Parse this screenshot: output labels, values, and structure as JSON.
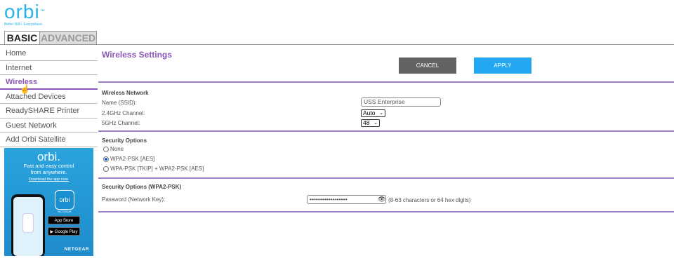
{
  "logo": {
    "brand": "orbi",
    "tm": "™",
    "tagline": "Better WiFi. Everywhere."
  },
  "tabs": {
    "basic": "BASIC",
    "advanced": "ADVANCED"
  },
  "sidebar": {
    "items": [
      {
        "label": "Home"
      },
      {
        "label": "Internet"
      },
      {
        "label": "Wireless"
      },
      {
        "label": "Attached Devices"
      },
      {
        "label": "ReadySHARE Printer"
      },
      {
        "label": "Guest Network"
      },
      {
        "label": "Add Orbi Satellite"
      }
    ],
    "active_index": 2
  },
  "ad": {
    "logo": "orbi.",
    "line1": "Fast and easy control",
    "line2": "from anywhere.",
    "link": "Download the app now.",
    "app_icon_label": "orbi",
    "app_icon_tag": "NETGEAR",
    "app_store": "App Store",
    "google_play": "Google Play",
    "brand": "NETGEAR"
  },
  "page": {
    "title": "Wireless Settings",
    "cancel_label": "CANCEL",
    "apply_label": "APPLY"
  },
  "wireless_network": {
    "title": "Wireless Network",
    "ssid_label": "Name (SSID):",
    "ssid_value": "USS Enterprise",
    "ch24_label": "2.4GHz Channel:",
    "ch24_value": "Auto",
    "ch5_label": "5GHz Channel:",
    "ch5_value": "48"
  },
  "security_options": {
    "title": "Security Options",
    "options": [
      "None",
      "WPA2-PSK [AES]",
      "WPA-PSK [TKIP] + WPA2-PSK [AES]"
    ],
    "selected_index": 1
  },
  "wpa2": {
    "title": "Security Options (WPA2-PSK)",
    "password_label": "Password (Network Key):",
    "password_value": "••••••••••••••••••",
    "hint": "(8-63 characters or 64 hex digits)"
  },
  "colors": {
    "accent": "#8a57b8",
    "apply": "#22a7f0",
    "cancel": "#636363",
    "brand": "#2ab3e6"
  }
}
